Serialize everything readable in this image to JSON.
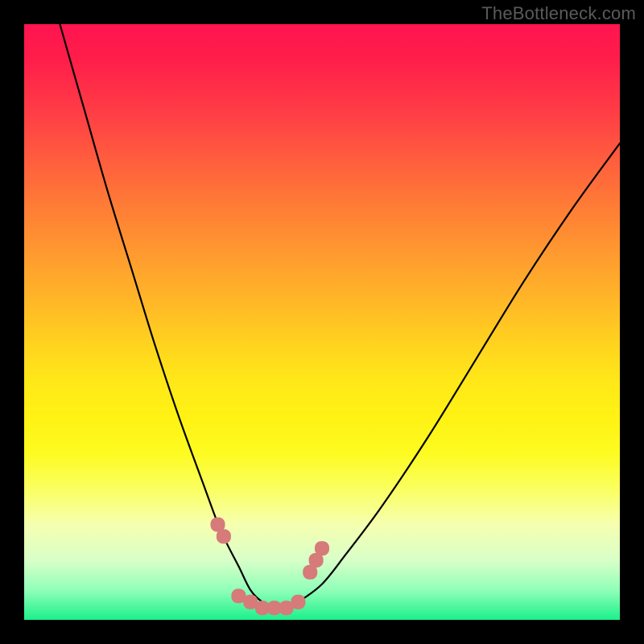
{
  "watermark": "TheBottleneck.com",
  "chart_data": {
    "type": "line",
    "title": "",
    "xlabel": "",
    "ylabel": "",
    "xlim": [
      0,
      100
    ],
    "ylim": [
      0,
      100
    ],
    "grid": false,
    "series": [
      {
        "name": "bottleneck-curve",
        "x": [
          6,
          10,
          14,
          18,
          22,
          26,
          30,
          33,
          36,
          38,
          40,
          42,
          44,
          46,
          50,
          54,
          60,
          68,
          76,
          84,
          92,
          100
        ],
        "values": [
          100,
          86,
          72,
          59,
          46,
          34,
          23,
          15,
          9,
          5,
          3,
          2,
          2,
          3,
          6,
          11,
          19,
          31,
          44,
          57,
          69,
          80
        ]
      }
    ],
    "markers": {
      "series": "bottleneck-curve",
      "color": "#d67a7a",
      "points_x": [
        32.5,
        33.5,
        36,
        38,
        40,
        42,
        44,
        46,
        48,
        49,
        50
      ],
      "points_y": [
        16,
        14,
        4,
        3,
        2,
        2,
        2,
        3,
        8,
        10,
        12
      ]
    }
  }
}
